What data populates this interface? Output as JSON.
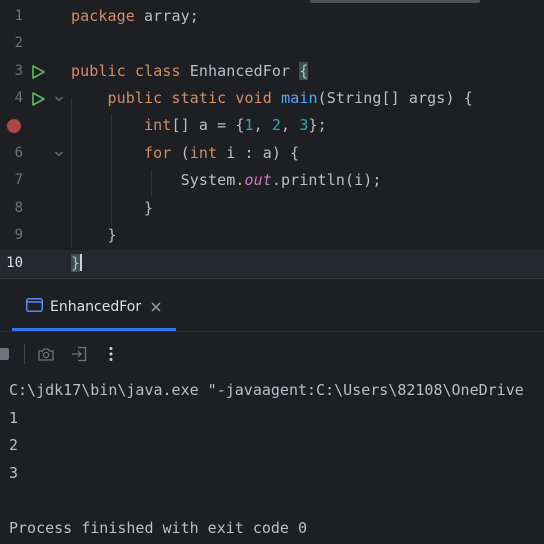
{
  "editor": {
    "line_numbers": [
      "1",
      "2",
      "3",
      "4",
      "5",
      "6",
      "7",
      "8",
      "9",
      "10"
    ],
    "tokens": {
      "package": "package",
      "package_name": " array;",
      "public": "public",
      "class": "class",
      "class_name": " EnhancedFor ",
      "open_brace": "{",
      "static": "static",
      "void": "void",
      "main": "main",
      "main_params": "(String[] args) {",
      "int": "int",
      "array_decl": "[] a = {",
      "n1": "1",
      "n2": "2",
      "n3": "3",
      "comma": ", ",
      "array_end": "};",
      "for": "for",
      "for_open": " (",
      "for_rest": " i : a) {",
      "system": "System.",
      "out": "out",
      "println": ".println(i);",
      "close_brace": "}"
    },
    "current_line": "10",
    "colors": {
      "keyword": "#cf8e6d",
      "method": "#56a8f5",
      "number": "#2aacb8",
      "static_field": "#c77dbb",
      "breakpoint": "#c94f4f",
      "run_gutter": "#5fb865"
    }
  },
  "run_panel": {
    "tab_label": "EnhancedFor",
    "tab_icon": "console-icon",
    "toolbar_icons": [
      "stop-icon",
      "camera-icon",
      "export-icon",
      "more-vertical-icon"
    ],
    "console_lines": [
      "C:\\jdk17\\bin\\java.exe \"-javaagent:C:\\Users\\82108\\OneDrive",
      "1",
      "2",
      "3",
      "",
      "Process finished with exit code 0"
    ],
    "accent": "#3574f0"
  }
}
